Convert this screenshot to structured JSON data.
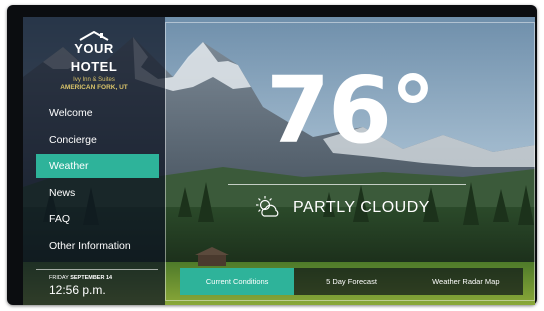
{
  "hotel": {
    "name_line1": "YOUR",
    "name_line2": "HOTEL",
    "brand": "Ivy Inn & Suites",
    "location": "AMERICAN FORK, UT"
  },
  "nav": {
    "items": [
      {
        "label": "Welcome"
      },
      {
        "label": "Concierge"
      },
      {
        "label": "Weather"
      },
      {
        "label": "News"
      },
      {
        "label": "FAQ"
      },
      {
        "label": "Other Information"
      }
    ],
    "active": "Weather"
  },
  "datetime": {
    "day": "FRIDAY",
    "date": "SEPTEMBER 14",
    "time": "12:56 p.m."
  },
  "weather": {
    "temperature": "76°",
    "condition": "PARTLY CLOUDY",
    "icon": "partly-cloudy-icon"
  },
  "tabs": [
    {
      "label": "Current Conditions"
    },
    {
      "label": "5 Day Forecast"
    },
    {
      "label": "Weather Radar Map"
    }
  ],
  "colors": {
    "accent": "#2eb39a",
    "gold": "#d9c36a"
  }
}
